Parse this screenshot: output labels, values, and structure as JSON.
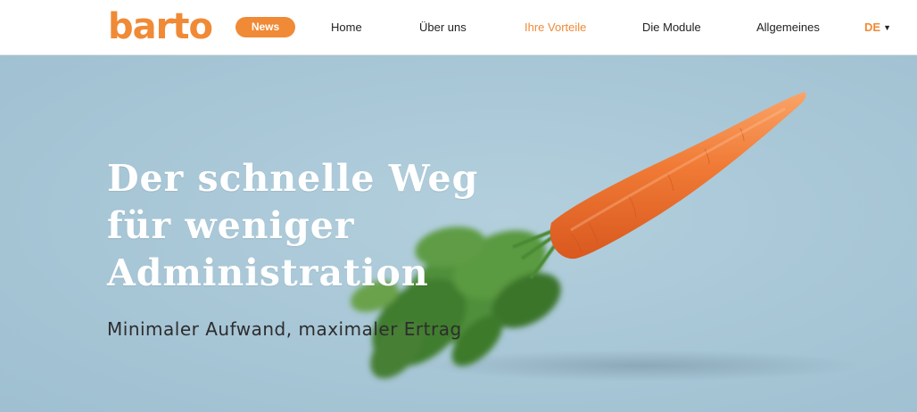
{
  "brand": {
    "logo_text": "barto"
  },
  "nav": {
    "news_label": "News",
    "links": [
      {
        "label": "Home",
        "active": false
      },
      {
        "label": "Über uns",
        "active": false
      },
      {
        "label": "Ihre Vorteile",
        "active": true
      },
      {
        "label": "Die Module",
        "active": false
      },
      {
        "label": "Allgemeines",
        "active": false
      }
    ],
    "language": "DE",
    "language_caret_icon": "caret-down-icon"
  },
  "hero": {
    "headline_line1": "Der schnelle Weg",
    "headline_line2": "für weniger",
    "headline_line3": "Administration",
    "subheadline": "Minimaler Aufwand, maximaler Ertrag",
    "image_subject": "carrot"
  },
  "colors": {
    "accent": "#f08a36",
    "hero_background": "#a9c7d7",
    "nav_text": "#222222",
    "headline_text": "#ffffff",
    "subheadline_text": "#2d2d2d"
  }
}
